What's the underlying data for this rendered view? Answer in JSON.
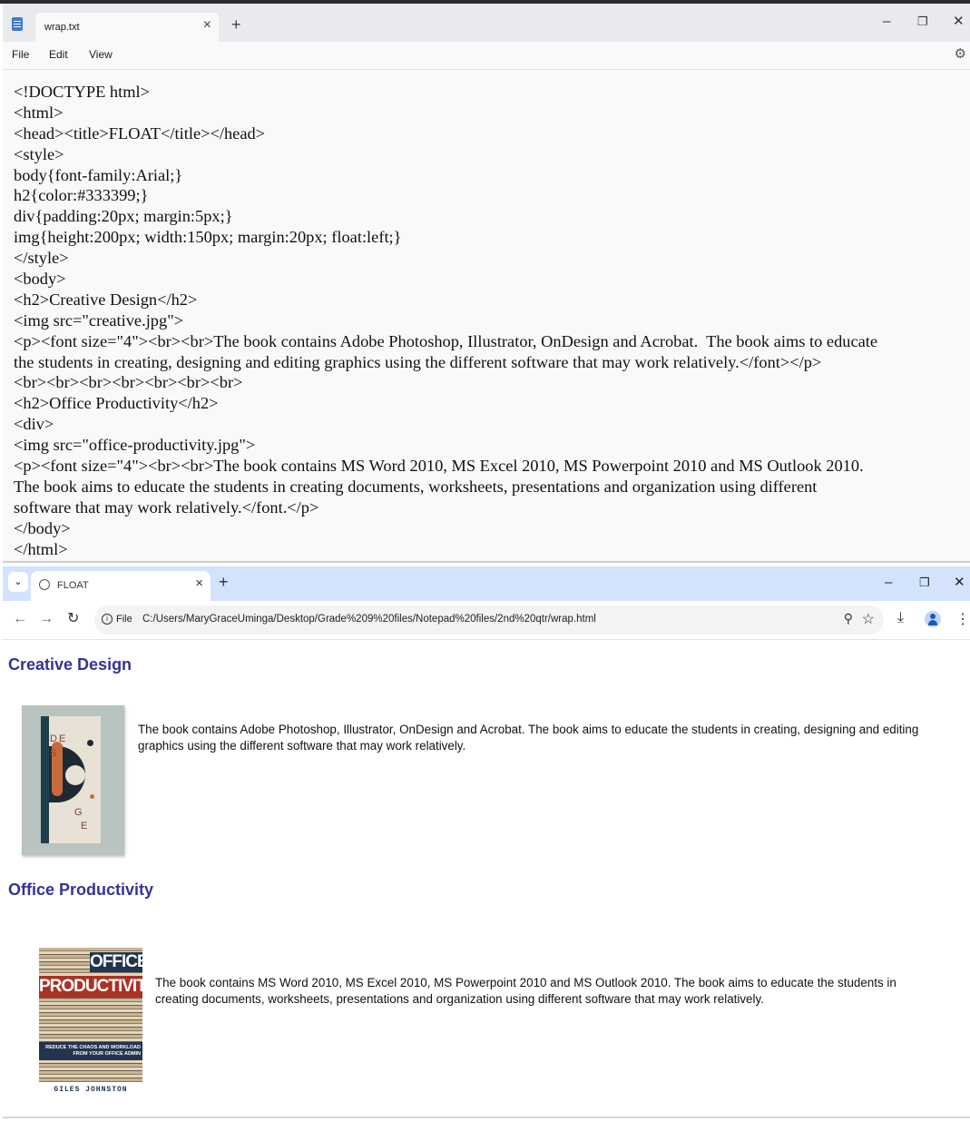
{
  "notepad": {
    "tab_title": "wrap.txt",
    "tab_close": "×",
    "new_tab": "+",
    "window_controls": {
      "minimize": "–",
      "restore": "❐",
      "close": "✕"
    },
    "menu": [
      "File",
      "Edit",
      "View"
    ],
    "settings_icon": "⚙",
    "lines": [
      "<!DOCTYPE html>",
      "<html>",
      "<head><title>FLOAT</title></head>",
      "<style>",
      "body{font-family:Arial;}",
      "h2{color:#333399;}",
      "div{padding:20px; margin:5px;}",
      "img{height:200px; width:150px; margin:20px; float:left;}",
      "</style>",
      "<body>",
      "<h2>Creative Design</h2>",
      "<img src=\"creative.jpg\">",
      "<p><font size=\"4\"><br><br>The book contains Adobe Photoshop, Illustrator, OnDesign and Acrobat.  The book aims to educate",
      "the students in creating, designing and editing graphics using the different software that may work relatively.</font></p>",
      "<br><br><br><br><br><br><br>",
      "<h2>Office Productivity</h2>",
      "<div>",
      "<img src=\"office-productivity.jpg\">",
      "<p><font size=\"4\"><br><br>The book contains MS Word 2010, MS Excel 2010, MS Powerpoint 2010 and MS Outlook 2010.",
      "The book aims to educate the students in creating documents, worksheets, presentations and organization using different",
      "software that may work relatively.</font.</p>",
      "</body>",
      "</html>"
    ]
  },
  "browser": {
    "tab_list_icon": "⌄",
    "tab_title": "FLOAT",
    "tab_close": "×",
    "new_tab": "+",
    "window_controls": {
      "minimize": "–",
      "restore": "❐",
      "close": "✕"
    },
    "nav": {
      "back": "←",
      "forward": "→",
      "reload": "↻"
    },
    "info_icon": "i",
    "scheme_label": "File",
    "url": "C:/Users/MaryGraceUminga/Desktop/Grade%209%20files/Notepad%20files/2nd%20qtr/wrap.html",
    "zoom_icon": "⚲",
    "star_icon": "☆",
    "download_icon": "⤓",
    "menu_icon": "⋮",
    "page": {
      "heading1": "Creative Design",
      "paragraph1": "The book contains Adobe Photoshop, Illustrator, OnDesign and Acrobat. The book aims to educate the students in creating, designing and editing graphics using the different software that may work relatively.",
      "heading2": "Office Productivity",
      "paragraph2": "The book contains MS Word 2010, MS Excel 2010, MS Powerpoint 2010 and MS Outlook 2010. The book aims to educate the students in creating documents, worksheets, presentations and organization using different software that may work relatively.",
      "cover1_letters": [
        "D",
        "E",
        "S",
        "G",
        "E"
      ],
      "cover2": {
        "word1": "OFFICE",
        "word2": "PRODUCTIVITY",
        "tagline1": "REDUCE THE CHAOS AND WORKLOAD",
        "tagline2": "FROM YOUR OFFICE ADMIN",
        "author": "GILES JOHNSTON"
      }
    }
  }
}
